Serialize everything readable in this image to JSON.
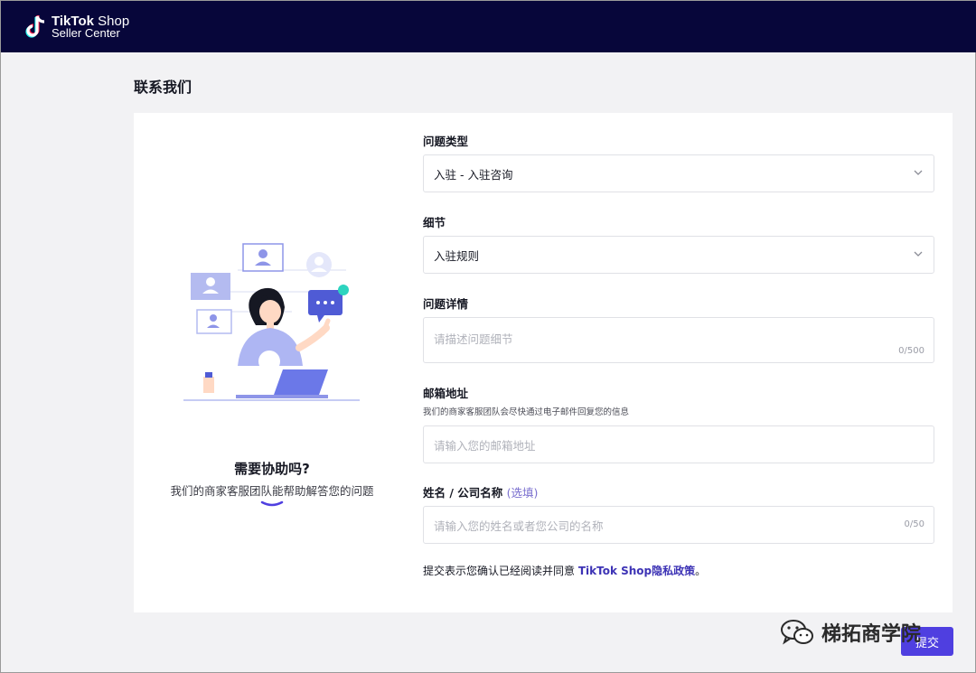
{
  "header": {
    "brand_line1_bold": "TikTok",
    "brand_line1": " Shop",
    "brand_line2": "Seller Center",
    "logo_icon": "tiktok-note-icon"
  },
  "page": {
    "title": "联系我们"
  },
  "help": {
    "title": "需要协助吗?",
    "subtitle": "我们的商家客服团队能帮助解答您的问题"
  },
  "form": {
    "issue_type": {
      "label": "问题类型",
      "value": "入驻 - 入驻咨询"
    },
    "detail": {
      "label": "细节",
      "value": "入驻规则"
    },
    "description": {
      "label": "问题详情",
      "placeholder": "请描述问题细节",
      "counter": "0/500"
    },
    "email": {
      "label": "邮箱地址",
      "hint": "我们的商家客服团队会尽快通过电子邮件回复您的信息",
      "placeholder": "请输入您的邮箱地址"
    },
    "name": {
      "label": "姓名 / 公司名称",
      "optional": "(选填)",
      "placeholder": "请输入您的姓名或者您公司的名称",
      "counter": "0/50"
    },
    "consent_prefix": "提交表示您确认已经阅读并同意 ",
    "consent_link": "TikTok Shop隐私政策",
    "consent_suffix": "。"
  },
  "actions": {
    "submit_label": "提交"
  },
  "overlay": {
    "brand_text": "梯拓商学院",
    "icon": "wechat-icon"
  },
  "colors": {
    "header_bg": "#07063a",
    "accent": "#4f3fe0",
    "link": "#3d33b5"
  }
}
